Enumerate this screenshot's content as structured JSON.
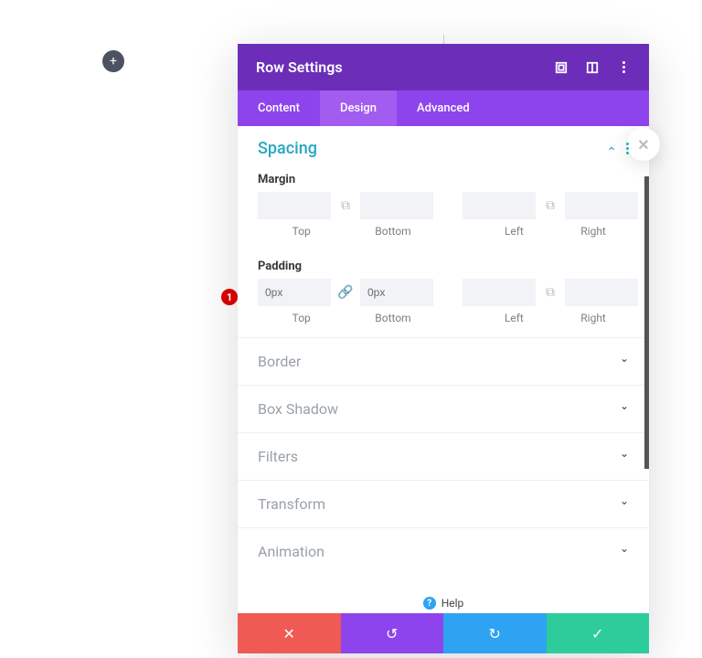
{
  "add_button_label": "+",
  "header": {
    "title": "Row Settings"
  },
  "tabs": {
    "content": "Content",
    "design": "Design",
    "advanced": "Advanced",
    "active": "design"
  },
  "spacing": {
    "title": "Spacing",
    "margin": {
      "label": "Margin",
      "top": {
        "value": "",
        "label": "Top"
      },
      "bottom": {
        "value": "",
        "label": "Bottom"
      },
      "left": {
        "value": "",
        "label": "Left"
      },
      "right": {
        "value": "",
        "label": "Right"
      },
      "linked_tb": false,
      "linked_lr": false
    },
    "padding": {
      "label": "Padding",
      "top": {
        "value": "0px",
        "label": "Top"
      },
      "bottom": {
        "value": "0px",
        "label": "Bottom"
      },
      "left": {
        "value": "",
        "label": "Left"
      },
      "right": {
        "value": "",
        "label": "Right"
      },
      "linked_tb": true,
      "linked_lr": false
    }
  },
  "collapsed_sections": {
    "border": "Border",
    "box_shadow": "Box Shadow",
    "filters": "Filters",
    "transform": "Transform",
    "animation": "Animation"
  },
  "help": {
    "label": "Help",
    "icon": "?"
  },
  "annotation": {
    "badge": "1"
  },
  "footer": {
    "cancel": "✕",
    "undo": "↺",
    "redo": "↻",
    "save": "✓"
  },
  "close_bubble": "✕"
}
